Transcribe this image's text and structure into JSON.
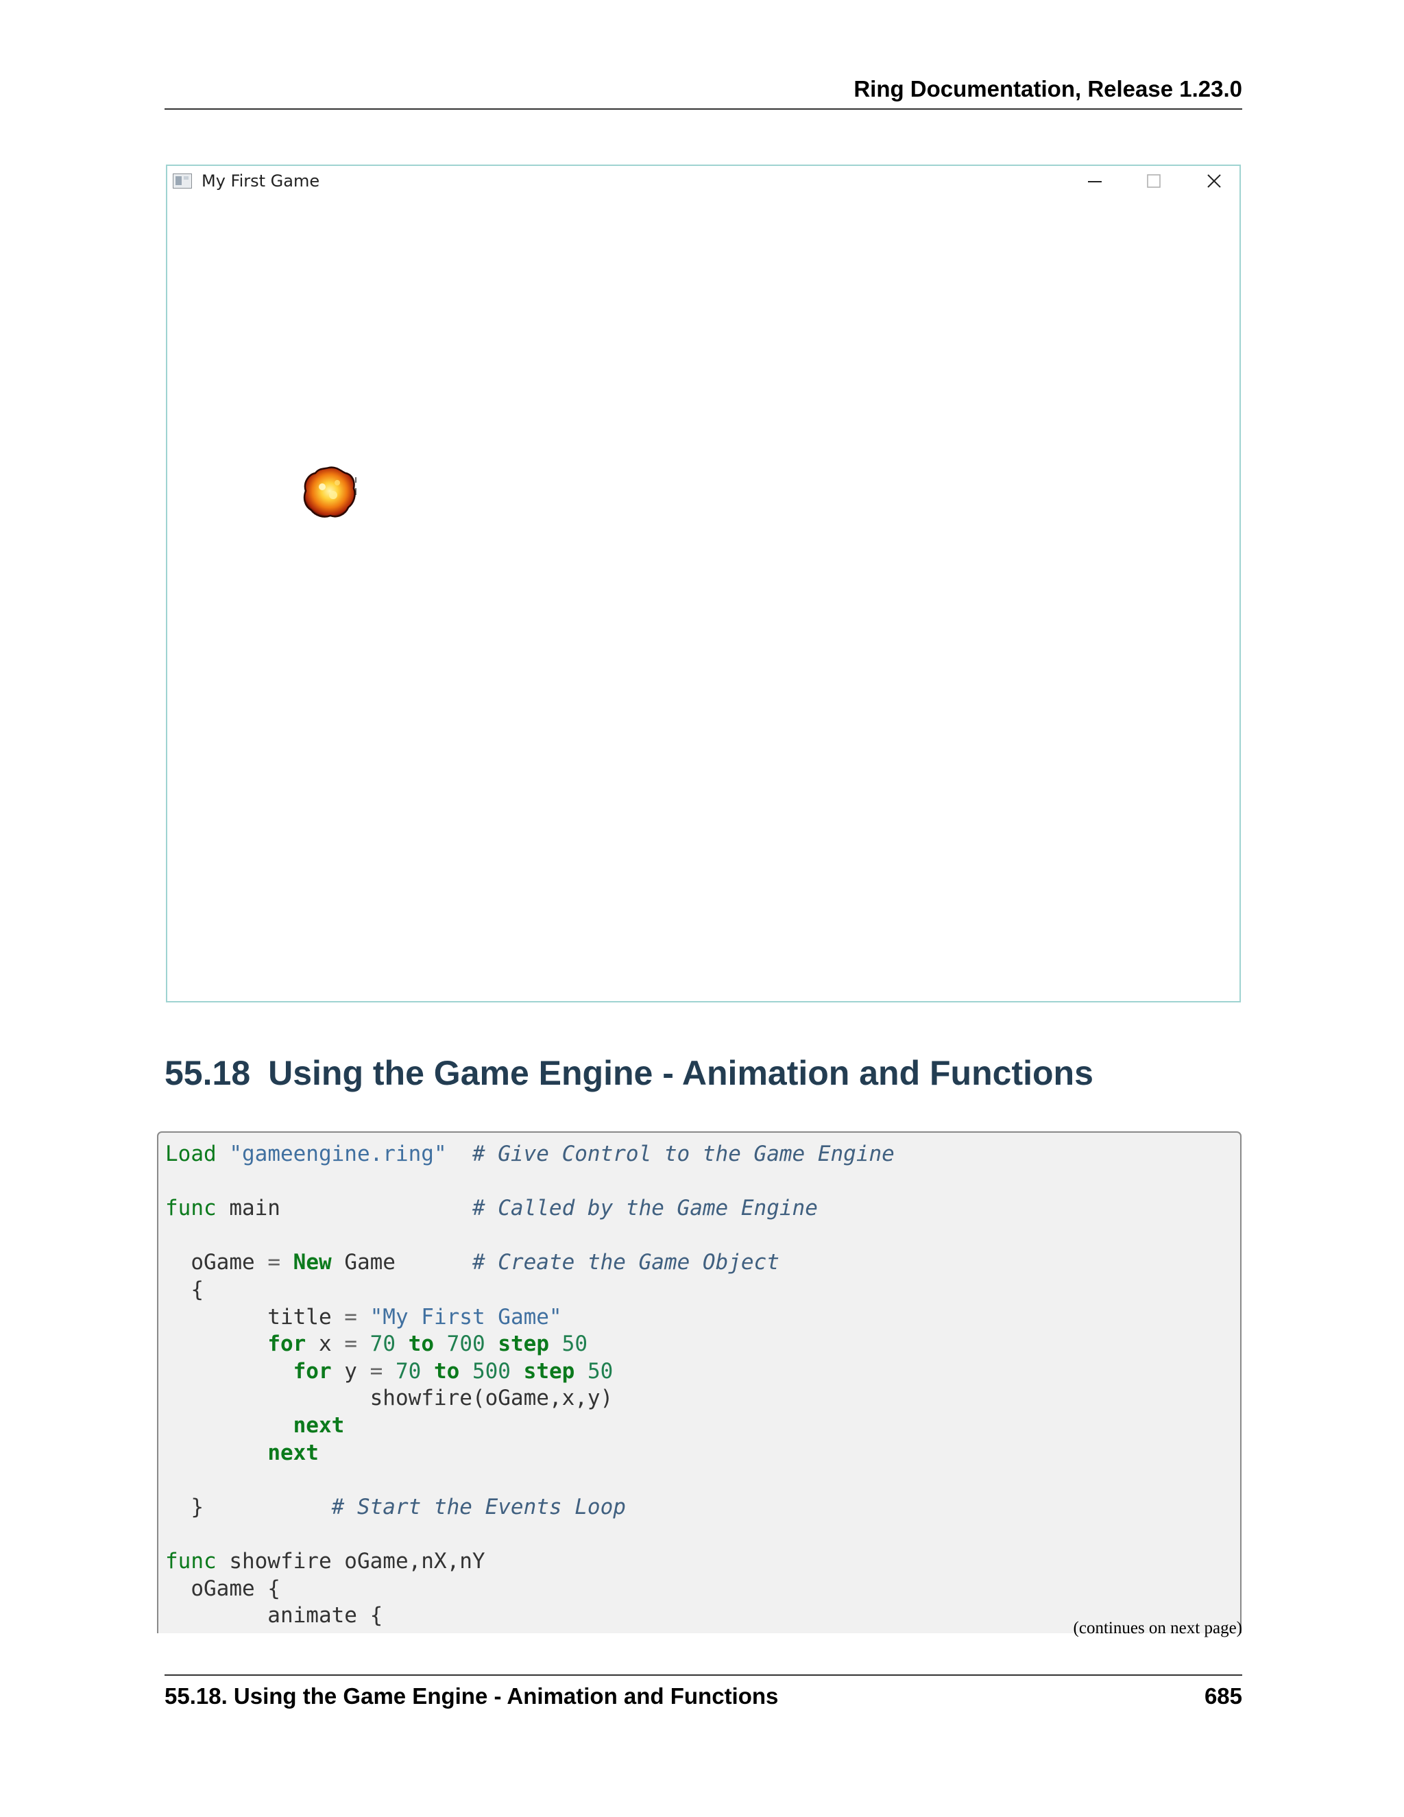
{
  "header": {
    "title": "Ring Documentation, Release 1.23.0"
  },
  "window": {
    "title": "My First Game",
    "icon": "app-window-icon",
    "controls": [
      "minimize-icon",
      "maximize-icon",
      "close-icon"
    ],
    "sprite": "fire-explosion-icon"
  },
  "section": {
    "number": "55.18",
    "title": "Using the Game Engine - Animation and Functions"
  },
  "code": {
    "lines": [
      "Load \"gameengine.ring\"  # Give Control to the Game Engine",
      "",
      "func main               # Called by the Game Engine",
      "",
      "  oGame = New Game      # Create the Game Object",
      "  {",
      "        title = \"My First Game\"",
      "        for x = 70 to 700 step 50",
      "          for y = 70 to 500 step 50",
      "                showfire(oGame,x,y)",
      "          next",
      "        next",
      "",
      "  }          # Start the Events Loop",
      "",
      "func showfire oGame,nX,nY",
      "  oGame {",
      "        animate {"
    ],
    "continues": "(continues on next page)"
  },
  "footer": {
    "section": "55.18.  Using the Game Engine - Animation and Functions",
    "page": "685"
  }
}
